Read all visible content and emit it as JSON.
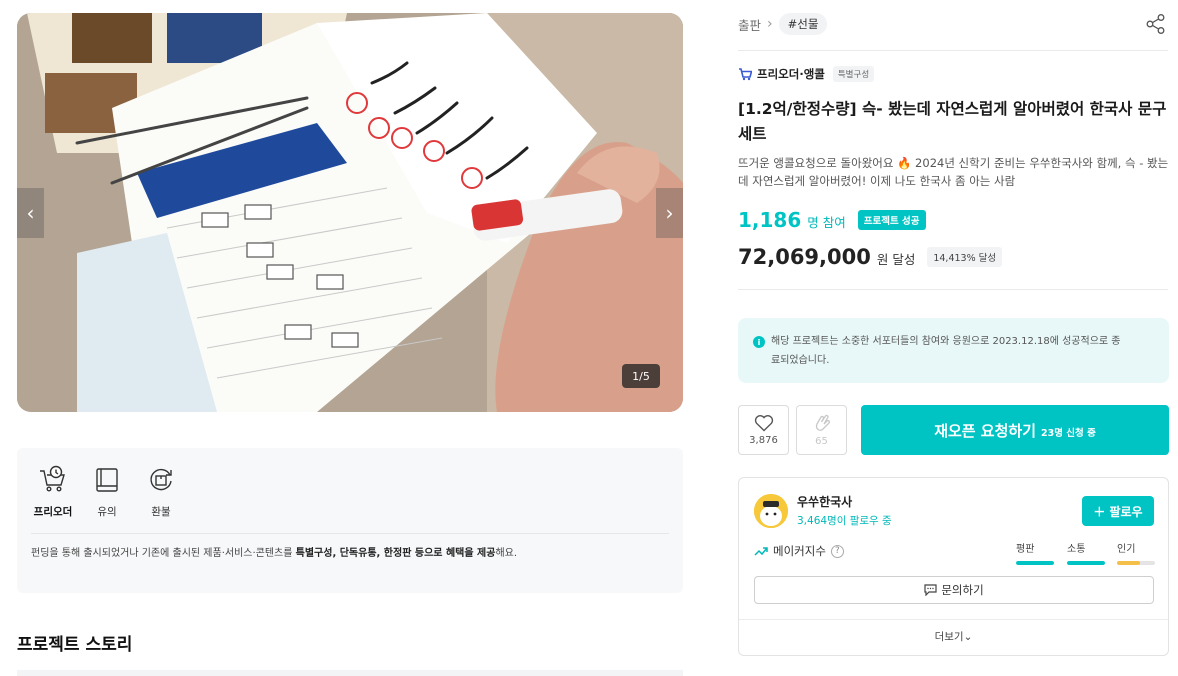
{
  "gallery": {
    "counter": "1/5",
    "prev_icon": "chevron-left-icon",
    "next_icon": "chevron-right-icon"
  },
  "badges": {
    "items": [
      {
        "label": "프리오더",
        "icon": "cart-clock-icon",
        "active": true
      },
      {
        "label": "유의",
        "icon": "book-icon",
        "active": false
      },
      {
        "label": "환불",
        "icon": "refund-box-icon",
        "active": false
      }
    ],
    "desc_prefix": "펀딩을 통해 출시되었거나 기존에 출시된 제품·서비스·콘텐츠를 ",
    "desc_bold": "특별구성, 단독유통, 한정판 등으로 혜택을 제공",
    "desc_suffix": "해요."
  },
  "story": {
    "title": "프로젝트 스토리"
  },
  "breadcrumb": {
    "category": "출판",
    "tag": "#선물"
  },
  "project": {
    "maker_label": "프리오더·앵콜",
    "special_pill": "특별구성",
    "title": "[1.2억/한정수량] 슥- 봤는데 자연스럽게 알아버렸어 한국사 문구 세트",
    "description": "뜨거운 앵콜요청으로 돌아왔어요 🔥 2024년 신학기 준비는 우쑤한국사와 함께, 슥 - 봤는데 자연스럽게 알아버렸어! 이제 나도 한국사 좀 아는 사람",
    "participants": "1,186",
    "participants_unit": "명 참여",
    "success_badge": "프로젝트 성공",
    "amount": "72,069,000",
    "amount_unit": "원 달성",
    "achievement": "14,413% 달성"
  },
  "notice": {
    "icon": "info-icon",
    "text": "해당 프로젝트는 소중한 서포터들의 참여와 응원으로 2023.12.18에 성공적으로 종료되었습니다."
  },
  "actions": {
    "like_count": "3,876",
    "cheer_count": "65",
    "reopen_label": "재오픈 요청하기",
    "reopen_sub": "23명 신청 중"
  },
  "maker": {
    "name": "우쑤한국사",
    "followers": "3,464명이 팔로우 중",
    "follow_label": "팔로우",
    "index_label": "메이커지수",
    "metrics": [
      {
        "label": "평판",
        "level": 1.0,
        "color": "#00c4c4"
      },
      {
        "label": "소통",
        "level": 1.0,
        "color": "#00c4c4"
      },
      {
        "label": "인기",
        "level": 0.6,
        "color": "#f5c04a"
      }
    ],
    "inquire_label": "문의하기",
    "more_label": "더보기"
  }
}
